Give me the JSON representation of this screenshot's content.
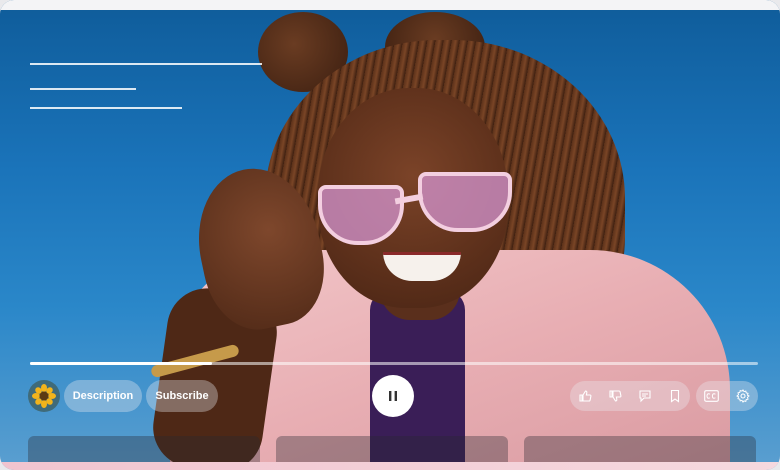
{
  "player": {
    "progress": 0.25,
    "state": "playing",
    "pause_icon": "pause-icon"
  },
  "controls": {
    "description_label": "Description",
    "subscribe_label": "Subscribe"
  },
  "channel": {
    "avatar_icon": "sunflower-avatar"
  },
  "actions": [
    {
      "icon": "thumbs-up-icon",
      "name": "like"
    },
    {
      "icon": "thumbs-down-icon",
      "name": "dislike"
    },
    {
      "icon": "comment-icon",
      "name": "comments"
    },
    {
      "icon": "bookmark-icon",
      "name": "save"
    },
    {
      "icon": "cc-icon",
      "name": "captions"
    },
    {
      "icon": "gear-icon",
      "name": "settings"
    }
  ],
  "colors": {
    "accent": "#ffffff",
    "background": "#1a73b9"
  }
}
